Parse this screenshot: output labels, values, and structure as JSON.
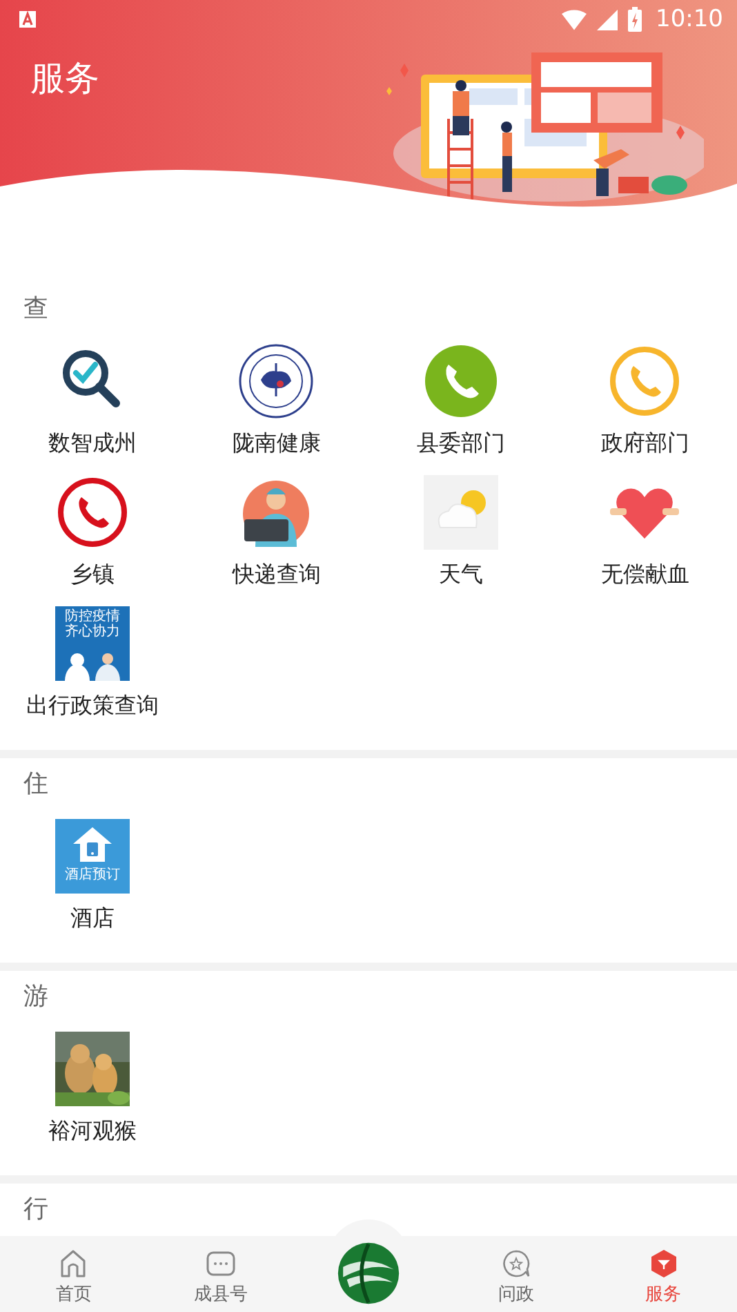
{
  "status_bar": {
    "time": "10:10"
  },
  "header": {
    "title": "服务"
  },
  "sections": [
    {
      "heading": "查",
      "items": [
        {
          "label": "数智成州",
          "kind": "magnifier"
        },
        {
          "label": "陇南健康",
          "kind": "emblem"
        },
        {
          "label": "县委部门",
          "kind": "phonesolid",
          "color": "#7ab51d"
        },
        {
          "label": "政府部门",
          "kind": "phonering",
          "color": "#f7b52c"
        },
        {
          "label": "乡镇",
          "kind": "phonering",
          "color": "#d7101c"
        },
        {
          "label": "快递查询",
          "kind": "courier"
        },
        {
          "label": "天气",
          "kind": "weather"
        },
        {
          "label": "无偿献血",
          "kind": "heart"
        },
        {
          "label": "出行政策查询",
          "kind": "poster",
          "badge_lines": [
            "防控疫情",
            "齐心协力"
          ]
        }
      ]
    },
    {
      "heading": "住",
      "items": [
        {
          "label": "酒店",
          "kind": "hotel",
          "badge_lines": [
            "酒店预订"
          ]
        }
      ]
    },
    {
      "heading": "游",
      "items": [
        {
          "label": "裕河观猴",
          "kind": "picture"
        }
      ]
    },
    {
      "heading": "行"
    }
  ],
  "nav": [
    {
      "kind": "home",
      "label": "首页",
      "selected": false
    },
    {
      "kind": "channel",
      "label": "成县号",
      "selected": false
    },
    {
      "kind": "logo"
    },
    {
      "kind": "inquiry",
      "label": "问政",
      "selected": false
    },
    {
      "kind": "service",
      "label": "服务",
      "selected": true
    }
  ]
}
